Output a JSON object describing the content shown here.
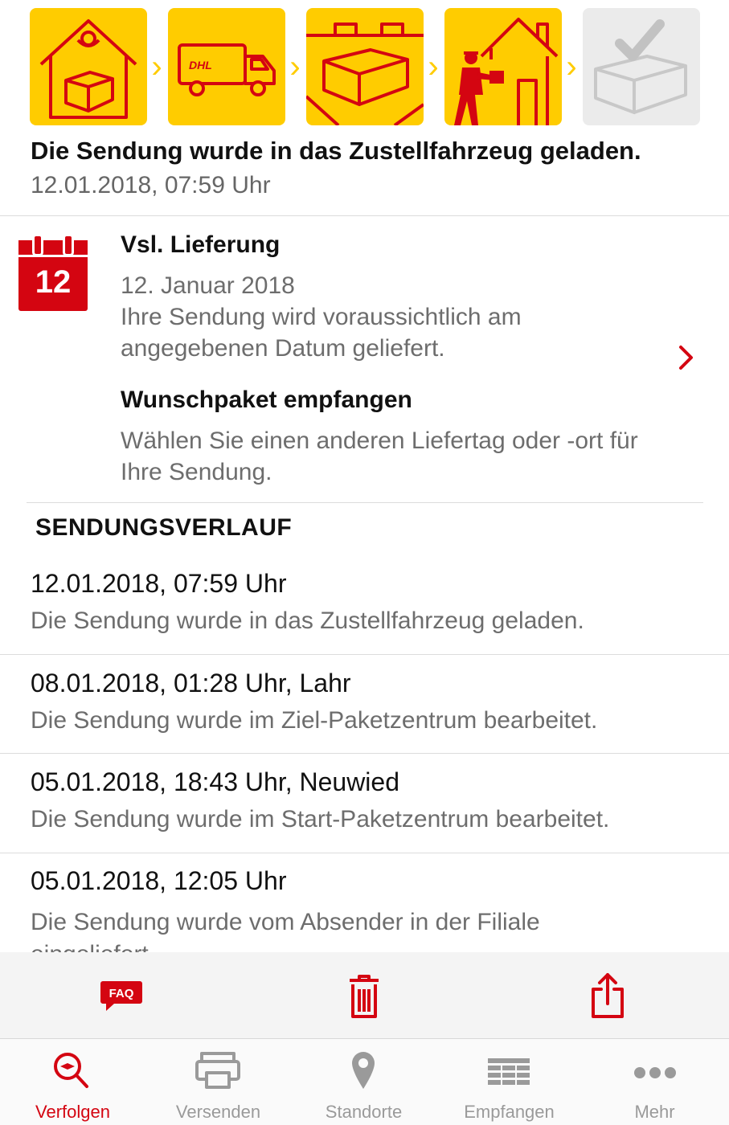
{
  "steps": [
    {
      "name": "package-at-post-office-icon",
      "state": "done"
    },
    {
      "name": "delivery-truck-icon",
      "state": "done",
      "logo_text": "DHL"
    },
    {
      "name": "package-in-transit-icon",
      "state": "done"
    },
    {
      "name": "courier-delivering-icon",
      "state": "done"
    },
    {
      "name": "delivered-checkmark-icon",
      "state": "pending"
    }
  ],
  "status": {
    "title": "Die Sendung wurde in das Zustellfahrzeug geladen.",
    "timestamp": "12.01.2018, 07:59 Uhr"
  },
  "delivery": {
    "calendar_day": "12",
    "heading": "Vsl. Lieferung",
    "date": "12. Januar 2018",
    "note": "Ihre Sendung wird voraussichtlich am angegebenen Datum geliefert.",
    "wish_heading": "Wunschpaket empfangen",
    "wish_text": "Wählen Sie einen anderen Liefertag oder -ort für Ihre Sendung."
  },
  "history": {
    "title": "SENDUNGSVERLAUF",
    "events": [
      {
        "time": "12.01.2018, 07:59 Uhr",
        "description": "Die Sendung wurde in das Zustellfahrzeug geladen."
      },
      {
        "time": "08.01.2018, 01:28 Uhr, Lahr",
        "description": "Die Sendung wurde im Ziel-Paketzentrum bearbeitet."
      },
      {
        "time": "05.01.2018, 18:43 Uhr, Neuwied",
        "description": "Die Sendung wurde im Start-Paketzentrum bearbeitet."
      },
      {
        "time": "05.01.2018, 12:05 Uhr",
        "description": "Die Sendung wurde vom Absender in der Filiale eingeliefert."
      }
    ]
  },
  "toolbar": {
    "faq_label": "FAQ",
    "icons": [
      "faq-icon",
      "trash-icon",
      "share-icon"
    ]
  },
  "tabs": [
    {
      "label": "Verfolgen",
      "icon": "track-search-icon",
      "active": true
    },
    {
      "label": "Versenden",
      "icon": "printer-icon",
      "active": false
    },
    {
      "label": "Standorte",
      "icon": "location-pin-icon",
      "active": false
    },
    {
      "label": "Empfangen",
      "icon": "mailbox-icon",
      "active": false
    },
    {
      "label": "Mehr",
      "icon": "more-dots-icon",
      "active": false
    }
  ],
  "colors": {
    "brand_yellow": "#FFCC00",
    "brand_red": "#D40511",
    "pending_grey": "#EBEBEB",
    "text_secondary": "#6D6D6D",
    "tab_inactive": "#9A9A9A"
  }
}
